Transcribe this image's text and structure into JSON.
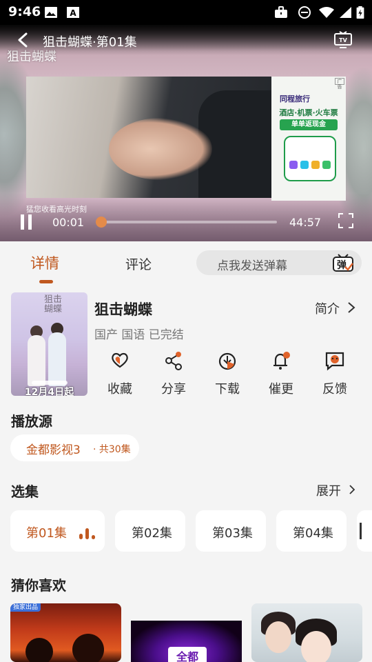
{
  "status_bar": {
    "time": "9:46",
    "left_icons": [
      "gallery-icon",
      "font-icon"
    ],
    "right_icons": [
      "briefcase-icon",
      "dnd-icon",
      "wifi-icon",
      "signal-icon",
      "battery-icon"
    ]
  },
  "player": {
    "episode_title": "狙击蝴蝶·第01集",
    "poster_watermark": "狙击蝴蝶",
    "hint": "猛您收看高光时刻",
    "current_time": "00:01",
    "total_time": "44:57",
    "progress_fraction": 0.002,
    "ad": {
      "brand": "同程旅行",
      "line1": "酒店·机票·火车票",
      "line2": "单单返现金",
      "tag": "广告"
    }
  },
  "tabs": {
    "detail": "详情",
    "comment": "评论",
    "danmu_placeholder": "点我发送弹幕",
    "danmu_icon_label": "弹"
  },
  "show": {
    "title": "狙击蝴蝶",
    "meta": "国产 国语 已完结",
    "intro_label": "简介",
    "poster_title": "狙击蝴蝶",
    "poster_date": "12月4日起"
  },
  "actions": [
    {
      "label": "收藏",
      "icon": "heart-collect-icon"
    },
    {
      "label": "分享",
      "icon": "share-icon"
    },
    {
      "label": "下载",
      "icon": "download-icon"
    },
    {
      "label": "催更",
      "icon": "bell-remind-icon"
    },
    {
      "label": "反馈",
      "icon": "feedback-icon"
    }
  ],
  "source": {
    "section_title": "播放源",
    "name": "金都影视3",
    "count": "· 共30集"
  },
  "episodes": {
    "section_title": "选集",
    "expand_label": "展开",
    "items": [
      "第01集",
      "第02集",
      "第03集",
      "第04集"
    ]
  },
  "recommend": {
    "section_title": "猜你喜欢",
    "card1_tag": "独家出品",
    "card2_logo": "全都"
  },
  "colors": {
    "accent": "#c0581f",
    "background": "#f4f4f4",
    "chip_bg": "#ffffff"
  }
}
